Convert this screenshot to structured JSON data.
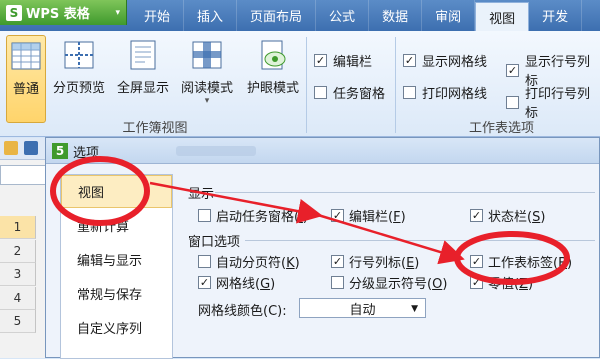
{
  "app": {
    "logo_char": "S",
    "title": "WPS 表格",
    "caret": "▾"
  },
  "tabs": [
    "开始",
    "插入",
    "页面布局",
    "公式",
    "数据",
    "审阅",
    "视图",
    "开发"
  ],
  "active_tab": "视图",
  "ribbon": {
    "view_buttons": [
      {
        "label": "普通",
        "active": true
      },
      {
        "label": "分页预览",
        "active": false
      },
      {
        "label": "全屏显示",
        "active": false
      },
      {
        "label": "阅读模式",
        "active": false,
        "caret": "▾"
      },
      {
        "label": "护眼模式",
        "active": false
      }
    ],
    "group_workbook_view": "工作簿视图",
    "checks_col1": [
      {
        "label": "编辑栏",
        "checked": true
      },
      {
        "label": "任务窗格",
        "checked": false
      }
    ],
    "checks_col2": [
      {
        "label": "显示网格线",
        "checked": true
      },
      {
        "label": "打印网格线",
        "checked": false
      }
    ],
    "checks_col3": [
      {
        "label": "显示行号列标",
        "checked": true
      },
      {
        "label": "打印行号列标",
        "checked": false
      }
    ],
    "group_sheet_options": "工作表选项"
  },
  "sheet": {
    "rows": [
      "1",
      "2",
      "3",
      "4",
      "5"
    ]
  },
  "dialog": {
    "logo_char": "5",
    "title": "选项",
    "nav": [
      "视图",
      "重新计算",
      "编辑与显示",
      "常规与保存",
      "自定义序列"
    ],
    "active_nav": "视图",
    "display_section": "显示",
    "display_options": [
      {
        "label": "启动任务窗格(",
        "key": "I",
        "tail": ")",
        "checked": false
      },
      {
        "label": "编辑栏(",
        "key": "F",
        "tail": ")",
        "checked": true
      },
      {
        "label": "状态栏(",
        "key": "S",
        "tail": ")",
        "checked": true
      }
    ],
    "window_section": "窗口选项",
    "window_options": [
      {
        "label": "自动分页符(",
        "key": "K",
        "tail": ")",
        "checked": false
      },
      {
        "label": "行号列标(",
        "key": "E",
        "tail": ")",
        "checked": true
      },
      {
        "label": "工作表标签(",
        "key": "B",
        "tail": ")",
        "checked": true
      },
      {
        "label": "网格线(",
        "key": "G",
        "tail": ")",
        "checked": true
      },
      {
        "label": "分级显示符号(",
        "key": "O",
        "tail": ")",
        "checked": false
      },
      {
        "label": "零值(",
        "key": "Z",
        "tail": ")",
        "checked": true
      }
    ],
    "gridline_color_label": "网格线颜色(C):",
    "gridline_color_value": "自动",
    "select_caret": "▼"
  },
  "colors": {
    "annotation": "#e8202a",
    "ribbon_accent": "#3d6fb0",
    "wps_green": "#3f9a2d"
  }
}
